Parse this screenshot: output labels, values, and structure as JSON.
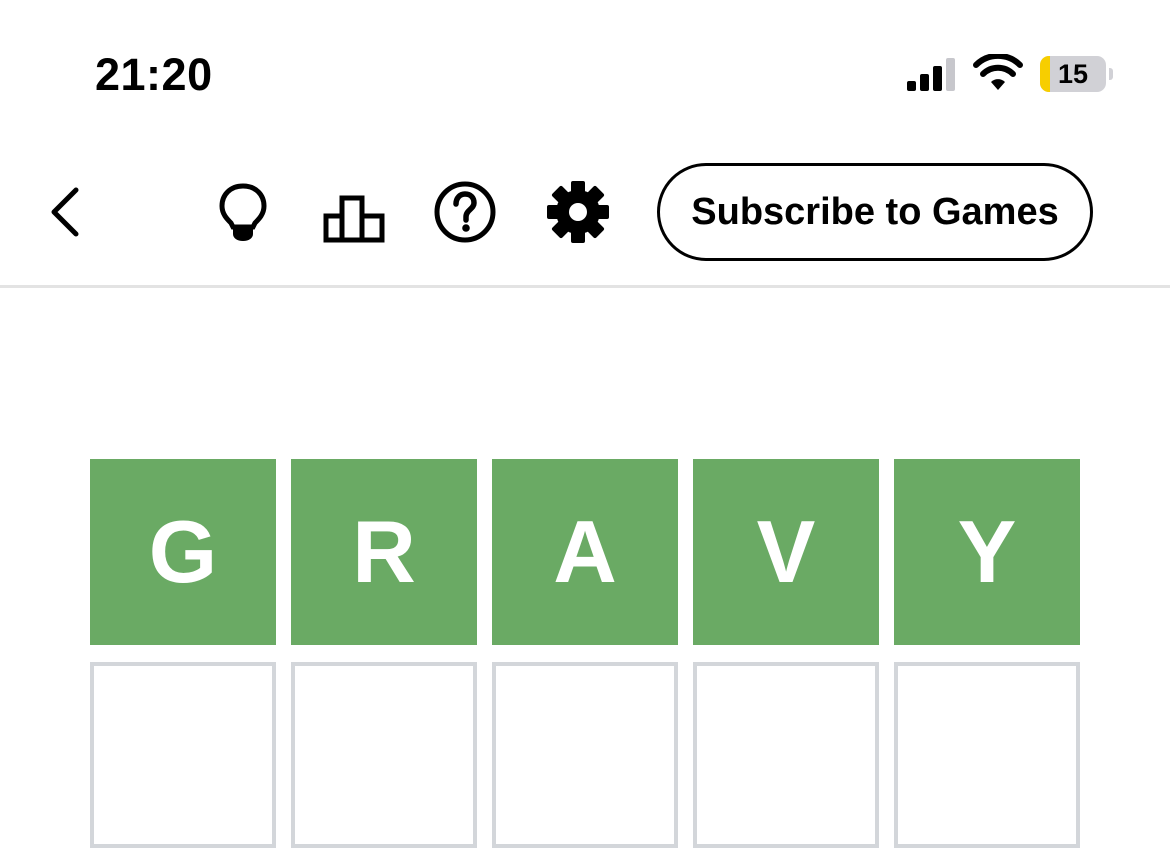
{
  "status_bar": {
    "time": "21:20",
    "battery_level": "15",
    "icons": [
      "signal-icon",
      "wifi-icon",
      "battery-icon"
    ]
  },
  "toolbar": {
    "back_icon": "chevron-left-icon",
    "icons": [
      "lightbulb-icon",
      "bar-chart-icon",
      "help-icon",
      "gear-icon"
    ],
    "subscribe_label": "Subscribe to Games"
  },
  "board": {
    "rows": [
      {
        "state": "correct",
        "letters": [
          "G",
          "R",
          "A",
          "V",
          "Y"
        ]
      },
      {
        "state": "empty",
        "letters": [
          "",
          "",
          "",
          "",
          ""
        ]
      }
    ]
  },
  "colors": {
    "correct": "#6aaa64",
    "empty_border": "#d3d6da",
    "battery_low": "#f7ce00"
  }
}
